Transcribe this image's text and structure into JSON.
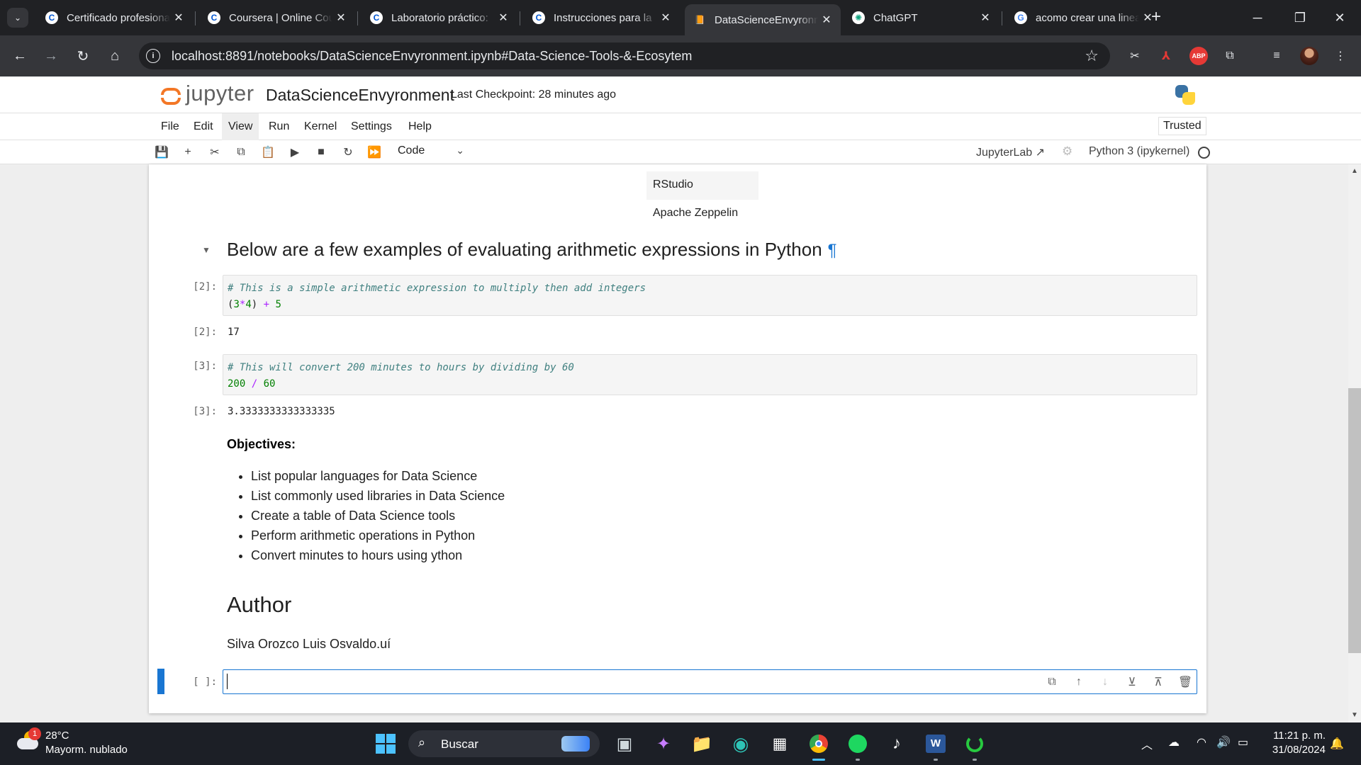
{
  "browser": {
    "tabs": [
      {
        "title": "Certificado profesional",
        "favicon": "coursera-icon"
      },
      {
        "title": "Coursera | Online Courses",
        "favicon": "coursera-icon"
      },
      {
        "title": "Laboratorio práctico:",
        "favicon": "coursera-icon"
      },
      {
        "title": "Instrucciones para la",
        "favicon": "coursera-icon"
      },
      {
        "title": "DataScienceEnvyronment",
        "favicon": "jupyter-icon",
        "active": true
      },
      {
        "title": "ChatGPT",
        "favicon": "chatgpt-icon"
      },
      {
        "title": "acomo crear una linea",
        "favicon": "google-icon"
      }
    ],
    "url": "localhost:8891/notebooks/DataScienceEnvyronment.ipynb#Data-Science-Tools-&-Ecosytem"
  },
  "jupyter": {
    "logo_text": "jupyter",
    "notebook_name": "DataScienceEnvyronment",
    "checkpoint": "Last Checkpoint: 28 minutes ago",
    "menu": [
      "File",
      "Edit",
      "View",
      "Run",
      "Kernel",
      "Settings",
      "Help"
    ],
    "trusted": "Trusted",
    "cell_type": "Code",
    "jupyterlab_link": "JupyterLab",
    "kernel_name": "Python 3 (ipykernel)"
  },
  "notebook": {
    "table_rows": [
      "RStudio",
      "Apache Zeppelin"
    ],
    "heading": "Below are a few examples of evaluating arithmetic expressions in Python",
    "pilcrow": "¶",
    "cell2": {
      "in_prompt": "[2]:",
      "comment": "# This is a simple arithmetic expression to multiply then add integers",
      "code": {
        "open": "(",
        "a": "3",
        "mul": "*",
        "b": "4",
        "close": ")",
        "plus": " + ",
        "c": "5"
      },
      "out_prompt": "[2]:",
      "output": "17"
    },
    "cell3": {
      "in_prompt": "[3]:",
      "comment": "# This will convert 200 minutes to hours by dividing by 60",
      "code": {
        "a": "200",
        "div": " / ",
        "b": "60"
      },
      "out_prompt": "[3]:",
      "output": "3.3333333333333335"
    },
    "objectives_title": "Objectives:",
    "objectives": [
      "List popular languages for Data Science",
      "List commonly used libraries in Data Science",
      "Create a table of Data Science tools",
      "Perform arithmetic operations in Python",
      "Convert minutes to hours using ython"
    ],
    "author_heading": "Author",
    "author_name": "Silva Orozco Luis Osvaldo.uí",
    "empty_prompt": "[ ]:"
  },
  "taskbar": {
    "weather_temp": "28°C",
    "weather_desc": "Mayorm. nublado",
    "weather_badge": "1",
    "search_placeholder": "Buscar",
    "time": "11:21 p. m.",
    "date": "31/08/2024"
  }
}
